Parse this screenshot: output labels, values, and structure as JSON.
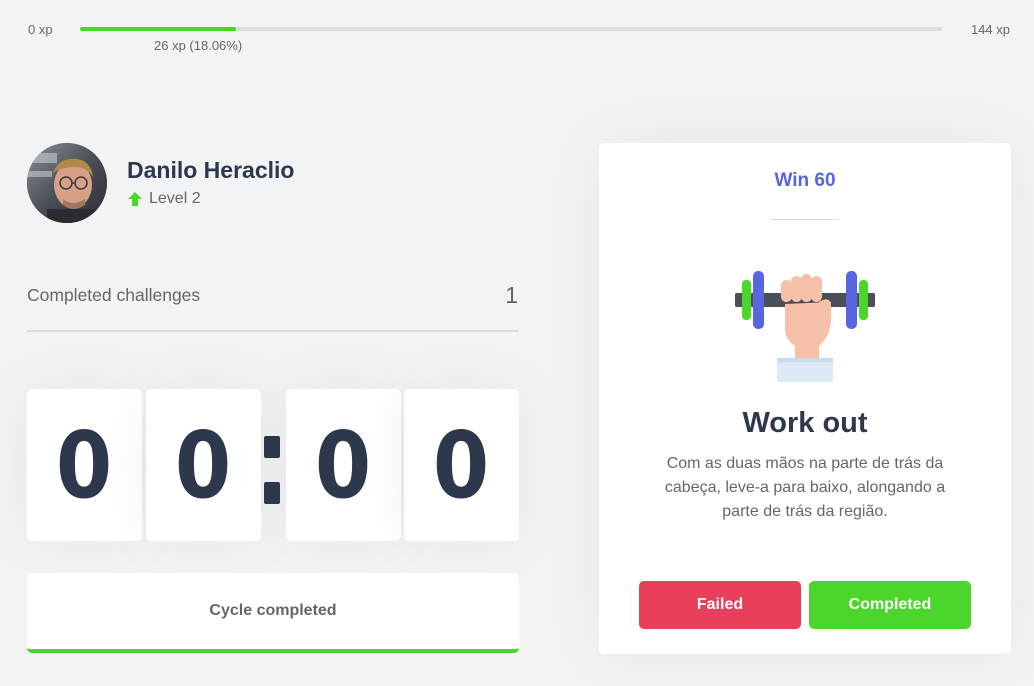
{
  "xp": {
    "min_label": "0 xp",
    "max_label": "144 xp",
    "current_label": "26 xp (18.06%)",
    "progress_percent": 18.06
  },
  "profile": {
    "name": "Danilo Heraclio",
    "level_label": "Level 2",
    "level_icon": "arrow-up-icon"
  },
  "challenges": {
    "label": "Completed challenges",
    "count": "1"
  },
  "countdown": {
    "minute_left": "0",
    "minute_right": "0",
    "second_left": "0",
    "second_right": "0"
  },
  "cycle_button": {
    "label": "Cycle completed"
  },
  "challenge_card": {
    "header": "Win 60",
    "icon": "dumbbell-icon",
    "title": "Work out",
    "description": "Com as duas mãos na parte de trás da cabeça, leve-a para baixo, alongando a parte de trás da região.",
    "failed_label": "Failed",
    "completed_label": "Completed"
  },
  "colors": {
    "background": "#f2f3f5",
    "green": "#4cd62b",
    "red": "#e83f5b",
    "blue": "#5965e0",
    "title": "#2e384d",
    "text": "#666666"
  }
}
